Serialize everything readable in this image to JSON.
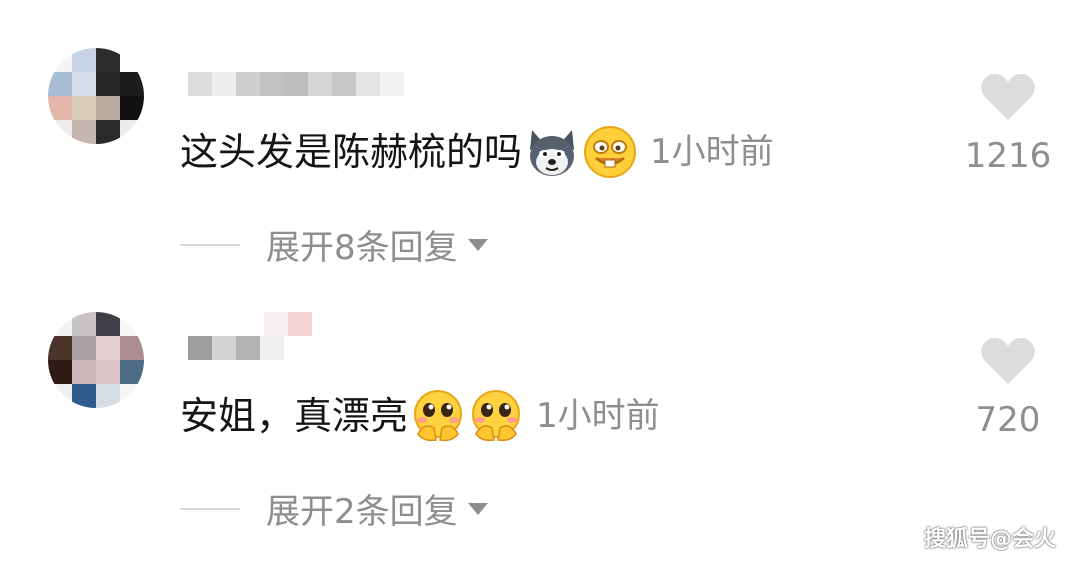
{
  "comments": [
    {
      "text": "这头发是陈赫梳的吗",
      "emojis": [
        "husky-dog-emoji",
        "grinning-buck-teeth-emoji"
      ],
      "time": "1小时前",
      "likes": "1216",
      "expand_label": "展开8条回复"
    },
    {
      "text": "安姐，真漂亮",
      "emojis": [
        "pleading-hands-emoji",
        "pleading-hands-emoji"
      ],
      "time": "1小时前",
      "likes": "720",
      "expand_label": "展开2条回复"
    }
  ],
  "watermark": "搜狐号@会火",
  "colors": {
    "text_primary": "#151515",
    "text_secondary": "#8e8e8e",
    "heart": "#dcdcdc"
  },
  "icons": {
    "like": "heart-icon",
    "expand": "caret-down-icon"
  }
}
